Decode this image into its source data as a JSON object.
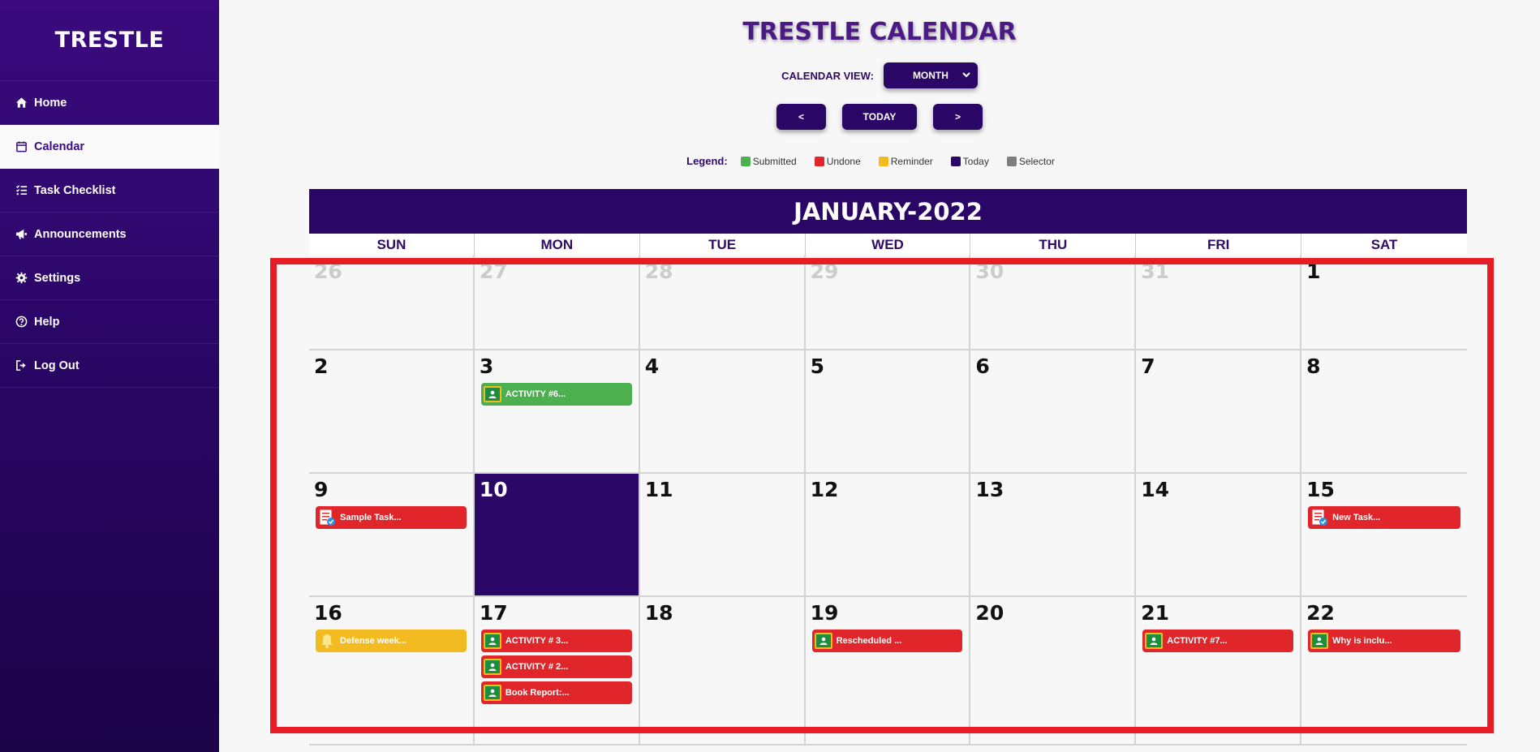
{
  "sidebar": {
    "brand": "TRESTLE",
    "items": [
      {
        "label": "Home",
        "icon": "home-icon"
      },
      {
        "label": "Calendar",
        "icon": "calendar-icon"
      },
      {
        "label": "Task Checklist",
        "icon": "checklist-icon"
      },
      {
        "label": "Announcements",
        "icon": "megaphone-icon"
      },
      {
        "label": "Settings",
        "icon": "gear-icon"
      },
      {
        "label": "Help",
        "icon": "help-icon"
      },
      {
        "label": "Log Out",
        "icon": "logout-icon"
      }
    ],
    "active": "Calendar"
  },
  "header": {
    "title": "TRESTLE CALENDAR",
    "view_label": "CALENDAR VIEW:",
    "view_value": "MONTH",
    "prev": "<",
    "today": "TODAY",
    "next": ">"
  },
  "legend": {
    "title": "Legend:",
    "items": [
      {
        "label": "Submitted",
        "color": "#4caf50"
      },
      {
        "label": "Undone",
        "color": "#e0262b"
      },
      {
        "label": "Reminder",
        "color": "#f3bb22"
      },
      {
        "label": "Today",
        "color": "#2a0666"
      },
      {
        "label": "Selector",
        "color": "#7f7f7f"
      }
    ]
  },
  "calendar": {
    "month_title": "JANUARY-2022",
    "days_of_week": [
      "SUN",
      "MON",
      "TUE",
      "WED",
      "THU",
      "FRI",
      "SAT"
    ],
    "weeks": [
      [
        {
          "day": "26",
          "other": true,
          "events": []
        },
        {
          "day": "27",
          "other": true,
          "events": []
        },
        {
          "day": "28",
          "other": true,
          "events": []
        },
        {
          "day": "29",
          "other": true,
          "events": []
        },
        {
          "day": "30",
          "other": true,
          "events": []
        },
        {
          "day": "31",
          "other": true,
          "events": []
        },
        {
          "day": "1",
          "events": []
        }
      ],
      [
        {
          "day": "2",
          "events": []
        },
        {
          "day": "3",
          "events": [
            {
              "label": "ACTIVITY #6...",
              "status": "submitted",
              "icon": "classroom-icon"
            }
          ]
        },
        {
          "day": "4",
          "events": []
        },
        {
          "day": "5",
          "events": []
        },
        {
          "day": "6",
          "events": []
        },
        {
          "day": "7",
          "events": []
        },
        {
          "day": "8",
          "events": []
        }
      ],
      [
        {
          "day": "9",
          "events": [
            {
              "label": "Sample Task...",
              "status": "undone",
              "icon": "task-icon"
            }
          ]
        },
        {
          "day": "10",
          "today": true,
          "events": []
        },
        {
          "day": "11",
          "events": []
        },
        {
          "day": "12",
          "events": []
        },
        {
          "day": "13",
          "events": []
        },
        {
          "day": "14",
          "events": []
        },
        {
          "day": "15",
          "events": [
            {
              "label": "New Task...",
              "status": "undone",
              "icon": "task-icon"
            }
          ]
        }
      ],
      [
        {
          "day": "16",
          "events": [
            {
              "label": "Defense week...",
              "status": "reminder",
              "icon": "bell-icon"
            }
          ]
        },
        {
          "day": "17",
          "events": [
            {
              "label": "ACTIVITY # 3...",
              "status": "undone",
              "icon": "classroom-icon"
            },
            {
              "label": "ACTIVITY # 2...",
              "status": "undone",
              "icon": "classroom-icon"
            },
            {
              "label": "Book Report:...",
              "status": "undone",
              "icon": "classroom-icon"
            }
          ]
        },
        {
          "day": "18",
          "events": []
        },
        {
          "day": "19",
          "events": [
            {
              "label": "Rescheduled ...",
              "status": "undone",
              "icon": "classroom-icon"
            }
          ]
        },
        {
          "day": "20",
          "events": []
        },
        {
          "day": "21",
          "events": [
            {
              "label": "ACTIVITY #7...",
              "status": "undone",
              "icon": "classroom-icon"
            }
          ]
        },
        {
          "day": "22",
          "events": [
            {
              "label": "Why is inclu...",
              "status": "undone",
              "icon": "classroom-icon"
            }
          ]
        }
      ]
    ]
  },
  "status_colors": {
    "submitted": "#4caf50",
    "undone": "#e0262b",
    "reminder": "#f3bb22"
  }
}
